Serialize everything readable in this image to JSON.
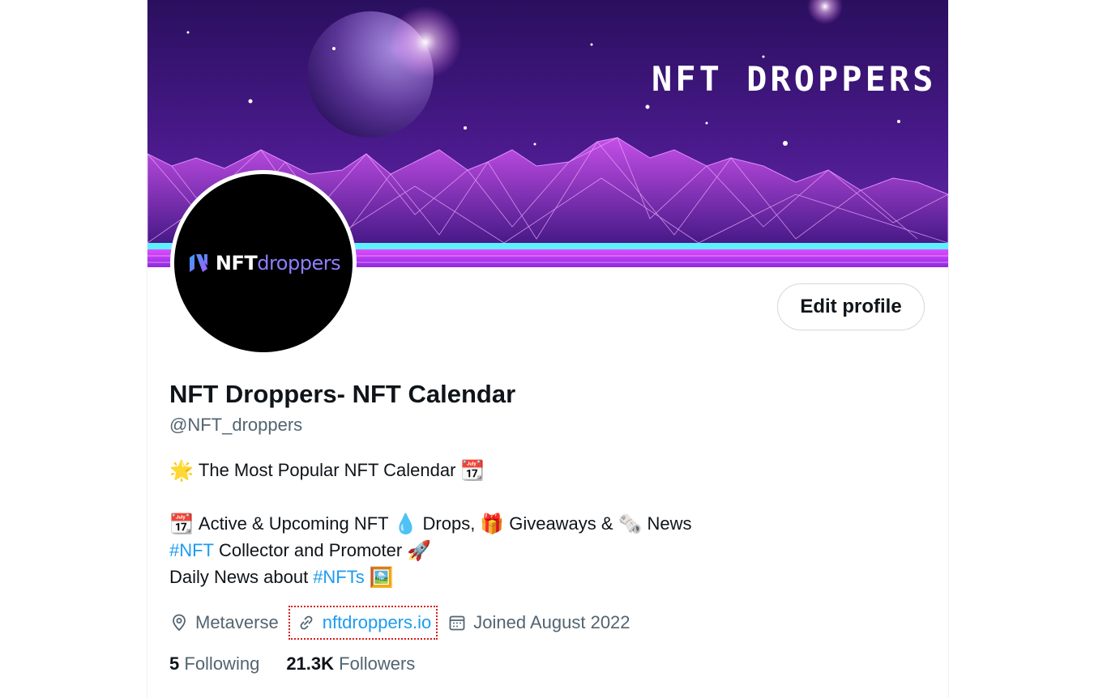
{
  "banner": {
    "title": "NFT DROPPERS"
  },
  "avatar": {
    "logo_prefix": "NFT",
    "logo_suffix": "droppers"
  },
  "edit_profile_label": "Edit profile",
  "profile": {
    "name": "NFT Droppers- NFT Calendar",
    "handle": "@NFT_droppers"
  },
  "bio": {
    "line1": {
      "emoji1": "🌟",
      "text": "The Most Popular NFT Calendar",
      "emoji2": "📆"
    },
    "line2": {
      "emoji1": "📆",
      "text1": "Active & Upcoming NFT",
      "emoji2": "💧",
      "text2": "Drops,",
      "emoji3": "🎁",
      "text3": "Giveaways &",
      "emoji4": "🗞️",
      "text4": "News"
    },
    "line3": {
      "hashtag": "#NFT",
      "text": "Collector and Promoter",
      "emoji": "🚀"
    },
    "line4": {
      "text": "Daily News about",
      "hashtag": "#NFTs",
      "emoji": "🖼️"
    }
  },
  "meta": {
    "location": "Metaverse",
    "website": "nftdroppers.io",
    "joined": "Joined August 2022"
  },
  "stats": {
    "following_count": "5",
    "following_label": "Following",
    "followers_count": "21.3K",
    "followers_label": "Followers"
  },
  "colors": {
    "link": "#1d9bf0",
    "secondary_text": "#536471",
    "primary_text": "#0f1419"
  }
}
